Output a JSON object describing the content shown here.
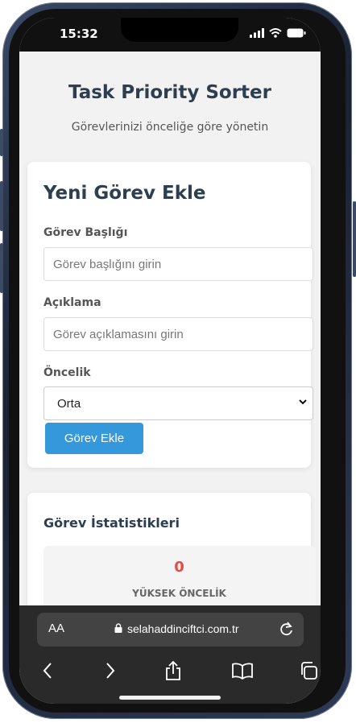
{
  "status_bar": {
    "time": "15:32"
  },
  "header": {
    "title": "Task Priority Sorter",
    "subtitle": "Görevlerinizi önceliğe göre yönetin"
  },
  "form": {
    "title": "Yeni Görev Ekle",
    "title_label": "Görev Başlığı",
    "title_placeholder": "Görev başlığını girin",
    "desc_label": "Açıklama",
    "desc_placeholder": "Görev açıklamasını girin",
    "priority_label": "Öncelik",
    "priority_value": "Orta",
    "submit_label": "Görev Ekle"
  },
  "stats": {
    "title": "Görev İstatistikleri",
    "items": [
      {
        "value": "0",
        "label": "YÜKSEK ÖNCELİK"
      }
    ]
  },
  "browser": {
    "aa_label": "AA",
    "url": "selahaddinciftci.com.tr"
  },
  "colors": {
    "accent": "#3498db",
    "high_priority": "#e74c3c",
    "heading": "#2c3e50"
  }
}
